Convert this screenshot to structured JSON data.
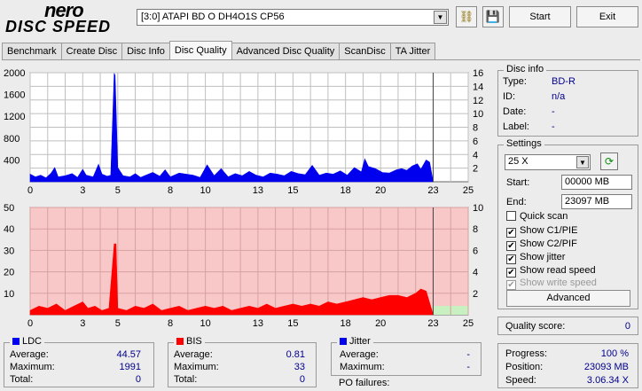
{
  "header": {
    "logo_top": "nero",
    "logo_bottom": "DISC SPEED",
    "drive": "[3:0]  ATAPI BD  O  DH4O1S CP56",
    "start_label": "Start",
    "exit_label": "Exit"
  },
  "tabs": [
    {
      "label": "Benchmark"
    },
    {
      "label": "Create Disc"
    },
    {
      "label": "Disc Info"
    },
    {
      "label": "Disc Quality",
      "active": true
    },
    {
      "label": "Advanced Disc Quality"
    },
    {
      "label": "ScanDisc"
    },
    {
      "label": "TA Jitter"
    }
  ],
  "chart_data": [
    {
      "type": "area",
      "series": [
        {
          "name": "LDC",
          "color": "#0000ee"
        },
        {
          "name": "Read Speed",
          "color": "#0000ee"
        }
      ],
      "x_ticks": [
        "0",
        "3",
        "5",
        "8",
        "10",
        "13",
        "15",
        "18",
        "20",
        "23",
        "25"
      ],
      "y_left_ticks": [
        "2000",
        "1600",
        "1200",
        "800",
        "400"
      ],
      "y_right_ticks": [
        "16",
        "14",
        "12",
        "10",
        "8",
        "6",
        "4",
        "2"
      ],
      "xlim": [
        0,
        25
      ],
      "ylim": [
        0,
        2000
      ],
      "y2lim": [
        0,
        16
      ],
      "grid": true,
      "values": [
        [
          0.0,
          140
        ],
        [
          0.3,
          90
        ],
        [
          0.6,
          120
        ],
        [
          0.9,
          70
        ],
        [
          1.2,
          160
        ],
        [
          1.4,
          260
        ],
        [
          1.6,
          90
        ],
        [
          2.0,
          110
        ],
        [
          2.4,
          150
        ],
        [
          2.7,
          80
        ],
        [
          3.0,
          230
        ],
        [
          3.2,
          120
        ],
        [
          3.6,
          90
        ],
        [
          3.9,
          320
        ],
        [
          4.1,
          140
        ],
        [
          4.4,
          100
        ],
        [
          4.6,
          120
        ],
        [
          4.8,
          1991
        ],
        [
          4.85,
          1950
        ],
        [
          5.0,
          260
        ],
        [
          5.3,
          110
        ],
        [
          5.7,
          90
        ],
        [
          6.0,
          150
        ],
        [
          6.3,
          80
        ],
        [
          6.6,
          120
        ],
        [
          7.0,
          170
        ],
        [
          7.4,
          100
        ],
        [
          7.7,
          220
        ],
        [
          8.0,
          90
        ],
        [
          8.5,
          160
        ],
        [
          8.9,
          140
        ],
        [
          9.3,
          120
        ],
        [
          9.7,
          80
        ],
        [
          10.1,
          310
        ],
        [
          10.5,
          110
        ],
        [
          10.9,
          240
        ],
        [
          11.3,
          90
        ],
        [
          11.7,
          150
        ],
        [
          12.1,
          110
        ],
        [
          12.5,
          190
        ],
        [
          12.9,
          120
        ],
        [
          13.3,
          90
        ],
        [
          13.7,
          160
        ],
        [
          14.1,
          140
        ],
        [
          14.5,
          110
        ],
        [
          14.9,
          190
        ],
        [
          15.3,
          150
        ],
        [
          15.7,
          130
        ],
        [
          16.1,
          300
        ],
        [
          16.5,
          120
        ],
        [
          16.9,
          160
        ],
        [
          17.3,
          140
        ],
        [
          17.7,
          200
        ],
        [
          18.1,
          120
        ],
        [
          18.5,
          260
        ],
        [
          18.9,
          180
        ],
        [
          19.1,
          420
        ],
        [
          19.3,
          280
        ],
        [
          19.7,
          240
        ],
        [
          20.1,
          170
        ],
        [
          20.5,
          160
        ],
        [
          20.9,
          220
        ],
        [
          21.2,
          240
        ],
        [
          21.5,
          210
        ],
        [
          21.8,
          290
        ],
        [
          22.1,
          330
        ],
        [
          22.3,
          230
        ],
        [
          22.6,
          400
        ],
        [
          22.8,
          360
        ],
        [
          23.0,
          0
        ]
      ]
    },
    {
      "type": "area",
      "series": [
        {
          "name": "BIS",
          "color": "#ff0000"
        }
      ],
      "x_ticks": [
        "0",
        "3",
        "5",
        "8",
        "10",
        "13",
        "15",
        "18",
        "20",
        "23",
        "25"
      ],
      "y_left_ticks": [
        "50",
        "40",
        "30",
        "20",
        "10"
      ],
      "y_right_ticks": [
        "10",
        "8",
        "6",
        "4",
        "2"
      ],
      "xlim": [
        0,
        25
      ],
      "ylim": [
        0,
        50
      ],
      "y2lim": [
        0,
        10
      ],
      "grid": true,
      "values": [
        [
          0.0,
          2
        ],
        [
          0.5,
          4
        ],
        [
          1.0,
          3
        ],
        [
          1.5,
          5
        ],
        [
          2.0,
          2
        ],
        [
          2.5,
          4
        ],
        [
          3.0,
          6
        ],
        [
          3.3,
          3
        ],
        [
          3.7,
          4
        ],
        [
          4.1,
          2
        ],
        [
          4.5,
          3
        ],
        [
          4.8,
          33
        ],
        [
          4.85,
          33
        ],
        [
          4.9,
          33
        ],
        [
          5.0,
          3
        ],
        [
          5.5,
          2
        ],
        [
          6.0,
          4
        ],
        [
          6.5,
          3
        ],
        [
          7.0,
          5
        ],
        [
          7.5,
          2
        ],
        [
          8.0,
          3
        ],
        [
          8.5,
          4
        ],
        [
          9.0,
          2
        ],
        [
          9.5,
          3
        ],
        [
          10.0,
          4
        ],
        [
          10.5,
          3
        ],
        [
          11.0,
          4
        ],
        [
          11.5,
          2
        ],
        [
          12.0,
          3
        ],
        [
          12.5,
          4
        ],
        [
          13.0,
          3
        ],
        [
          13.5,
          5
        ],
        [
          14.0,
          3
        ],
        [
          14.5,
          4
        ],
        [
          15.0,
          5
        ],
        [
          15.5,
          4
        ],
        [
          16.0,
          5
        ],
        [
          16.5,
          4
        ],
        [
          17.0,
          6
        ],
        [
          17.5,
          5
        ],
        [
          18.0,
          6
        ],
        [
          18.5,
          7
        ],
        [
          19.0,
          8
        ],
        [
          19.5,
          7
        ],
        [
          20.0,
          8
        ],
        [
          20.5,
          9
        ],
        [
          21.0,
          9
        ],
        [
          21.5,
          8
        ],
        [
          22.0,
          10
        ],
        [
          22.3,
          12
        ],
        [
          22.6,
          11
        ],
        [
          23.0,
          0
        ]
      ]
    }
  ],
  "disc_info": {
    "title": "Disc info",
    "type_label": "Type:",
    "type_value": "BD-R",
    "id_label": "ID:",
    "id_value": "n/a",
    "date_label": "Date:",
    "date_value": "-",
    "label_label": "Label:",
    "label_value": "-"
  },
  "settings": {
    "title": "Settings",
    "speed": "25 X",
    "start_label": "Start:",
    "start_value": "00000 MB",
    "end_label": "End:",
    "end_value": "23097 MB",
    "quick_scan": "Quick scan",
    "show_c1": "Show C1/PIE",
    "show_c2": "Show C2/PIF",
    "show_jitter": "Show jitter",
    "show_read": "Show read speed",
    "show_write": "Show write speed",
    "advanced_label": "Advanced"
  },
  "quality": {
    "label": "Quality score:",
    "value": "0"
  },
  "progress": {
    "progress_label": "Progress:",
    "progress_value": "100 %",
    "position_label": "Position:",
    "position_value": "23093 MB",
    "speed_label": "Speed:",
    "speed_value": "3.06.34 X"
  },
  "ldc": {
    "title": "LDC",
    "color": "#0000ee",
    "avg_label": "Average:",
    "avg": "44.57",
    "max_label": "Maximum:",
    "max": "1991",
    "total_label": "Total:",
    "total": "0"
  },
  "bis": {
    "title": "BIS",
    "color": "#ff0000",
    "avg_label": "Average:",
    "avg": "0.81",
    "max_label": "Maximum:",
    "max": "33",
    "total_label": "Total:",
    "total": "0"
  },
  "jitter": {
    "title": "Jitter",
    "color": "#0000ee",
    "avg_label": "Average:",
    "avg": "-",
    "max_label": "Maximum:",
    "max": "-",
    "po_label": "PO failures:"
  }
}
